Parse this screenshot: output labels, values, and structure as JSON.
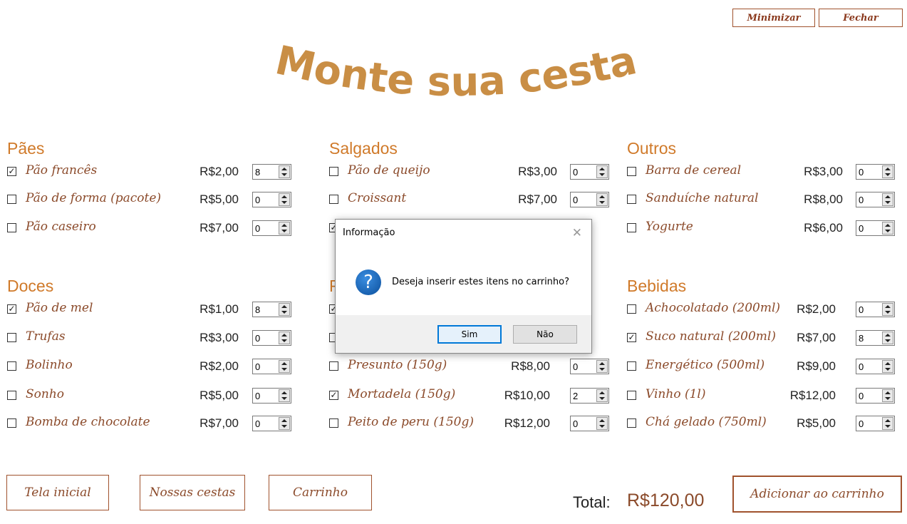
{
  "window": {
    "minimize_label": "Minimizar",
    "close_label": "Fechar"
  },
  "title": "Monte sua cesta",
  "colors": {
    "accent": "#d07a2a",
    "title": "#c98e45",
    "item_text": "#8b4a2a",
    "border": "#a0522d"
  },
  "sections": {
    "paes": {
      "label": "Pães",
      "items": [
        {
          "label": "Pão francês",
          "price": "R$2,00",
          "qty": "8",
          "checked": true
        },
        {
          "label": "Pão de forma (pacote)",
          "price": "R$5,00",
          "qty": "0",
          "checked": false
        },
        {
          "label": "Pão caseiro",
          "price": "R$7,00",
          "qty": "0",
          "checked": false
        }
      ]
    },
    "salgados": {
      "label": "Salgados",
      "items": [
        {
          "label": "Pão de queijo",
          "price": "R$3,00",
          "qty": "0",
          "checked": false
        },
        {
          "label": "Croissant",
          "price": "R$7,00",
          "qty": "0",
          "checked": false
        },
        {
          "label": "",
          "price": "",
          "qty": "",
          "checked": true
        }
      ]
    },
    "outros": {
      "label": "Outros",
      "items": [
        {
          "label": "Barra de cereal",
          "price": "R$3,00",
          "qty": "0",
          "checked": false
        },
        {
          "label": "Sanduíche natural",
          "price": "R$8,00",
          "qty": "0",
          "checked": false
        },
        {
          "label": "Yogurte",
          "price": "R$6,00",
          "qty": "0",
          "checked": false
        }
      ]
    },
    "doces": {
      "label": "Doces",
      "items": [
        {
          "label": "Pão de mel",
          "price": "R$1,00",
          "qty": "8",
          "checked": true
        },
        {
          "label": "Trufas",
          "price": "R$3,00",
          "qty": "0",
          "checked": false
        },
        {
          "label": "Bolinho",
          "price": "R$2,00",
          "qty": "0",
          "checked": false
        },
        {
          "label": "Sonho",
          "price": "R$5,00",
          "qty": "0",
          "checked": false
        },
        {
          "label": "Bomba de chocolate",
          "price": "R$7,00",
          "qty": "0",
          "checked": false
        }
      ]
    },
    "frios": {
      "label": "F",
      "items": [
        {
          "label": "",
          "price": "",
          "qty": "",
          "checked": true
        },
        {
          "label": "",
          "price": "",
          "qty": "",
          "checked": false
        },
        {
          "label": "Presunto (150g)",
          "price": "R$8,00",
          "qty": "0",
          "checked": false
        },
        {
          "label": "Mortadela (150g)",
          "price": "R$10,00",
          "qty": "2",
          "checked": true
        },
        {
          "label": "Peito de peru (150g)",
          "price": "R$12,00",
          "qty": "0",
          "checked": false
        }
      ]
    },
    "bebidas": {
      "label": "Bebidas",
      "items": [
        {
          "label": "Achocolatado (200ml)",
          "price": "R$2,00",
          "qty": "0",
          "checked": false
        },
        {
          "label": "Suco natural (200ml)",
          "price": "R$7,00",
          "qty": "8",
          "checked": true
        },
        {
          "label": "Energético (500ml)",
          "price": "R$9,00",
          "qty": "0",
          "checked": false
        },
        {
          "label": "Vinho (1l)",
          "price": "R$12,00",
          "qty": "0",
          "checked": false
        },
        {
          "label": "Chá gelado (750ml)",
          "price": "R$5,00",
          "qty": "0",
          "checked": false
        }
      ]
    }
  },
  "nav": {
    "home_label": "Tela inicial",
    "baskets_label": "Nossas cestas",
    "cart_label": "Carrinho"
  },
  "total": {
    "label": "Total:",
    "value": "R$120,00"
  },
  "add_to_cart_label": "Adicionar ao carrinho",
  "dialog": {
    "title": "Informação",
    "close_glyph": "✕",
    "icon_glyph": "?",
    "message": "Deseja inserir estes itens no carrinho?",
    "yes_label": "Sim",
    "no_label": "Não"
  }
}
